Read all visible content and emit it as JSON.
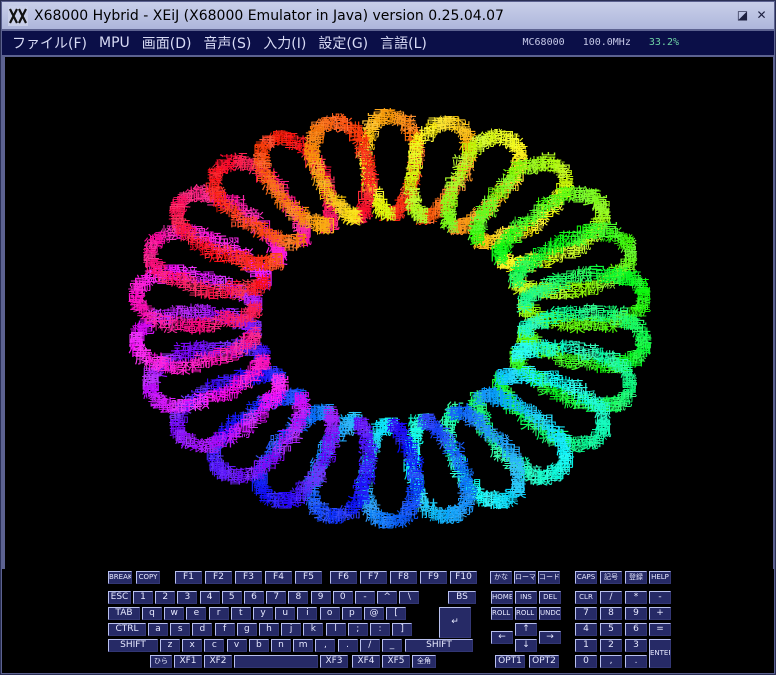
{
  "window": {
    "title": "X68000 Hybrid - XEiJ (X68000 Emulator in Java) version 0.25.04.07",
    "buttons": [
      "◪",
      "✕"
    ]
  },
  "menu": [
    "ファイル(F)",
    "MPU",
    "画面(D)",
    "音声(S)",
    "入力(I)",
    "設定(G)",
    "言語(L)"
  ],
  "status": {
    "cpu": "MC68000",
    "clock": "100.0MHz",
    "load": "33.2%"
  },
  "colors": {
    "menubar": "#0b0f48",
    "window": "#5c6290",
    "titlebar": "#c9cfe9",
    "key": "#262a66"
  },
  "screen": {
    "kanji": [
      "漢",
      "宇",
      "宙",
      "森",
      "林",
      "雪",
      "楽",
      "鳴",
      "樹",
      "街",
      "線",
      "語",
      "愛",
      "瀬",
      "龍",
      "夢",
      "鏡",
      "闇",
      "風",
      "響",
      "雲",
      "嵐",
      "電",
      "端",
      "機",
      "燈",
      "橋",
      "藤",
      "鶴",
      "曜"
    ]
  },
  "keyboard": {
    "row1": [
      "BREAK",
      "COPY",
      "F1",
      "F2",
      "F3",
      "F4",
      "F5",
      "F6",
      "F7",
      "F8",
      "F9",
      "F10",
      "かな",
      "ローマ",
      "コード",
      "CAPS",
      "記号",
      "登録",
      "HELP"
    ],
    "row2": [
      "ESC",
      "1",
      "2",
      "3",
      "4",
      "5",
      "6",
      "7",
      "8",
      "9",
      "0",
      "-",
      "^",
      "\\",
      "BS",
      "HOME",
      "INS",
      "DEL",
      "CLR",
      "/",
      "*",
      "-"
    ],
    "row3": [
      "TAB",
      "q",
      "w",
      "e",
      "r",
      "t",
      "y",
      "u",
      "i",
      "o",
      "p",
      "@",
      "[",
      "ROLL UP",
      "ROLL DOWN",
      "UNDO",
      "7",
      "8",
      "9",
      "+"
    ],
    "row4": [
      "CTRL",
      "a",
      "s",
      "d",
      "f",
      "g",
      "h",
      "j",
      "k",
      "l",
      ";",
      ":",
      "]",
      "↵",
      "↑",
      "4",
      "5",
      "6",
      "="
    ],
    "row5": [
      "SHIFT",
      "z",
      "x",
      "c",
      "v",
      "b",
      "n",
      "m",
      ",",
      ".",
      "/",
      "_",
      "SHIFT",
      "←",
      "→",
      "1",
      "2",
      "3"
    ],
    "row6": [
      "ひら",
      "XF1",
      "XF2",
      "",
      "XF3",
      "XF4",
      "XF5",
      "全角",
      "OPT1",
      "OPT2",
      "0",
      ",",
      ".",
      "ENTER",
      "↓"
    ]
  }
}
